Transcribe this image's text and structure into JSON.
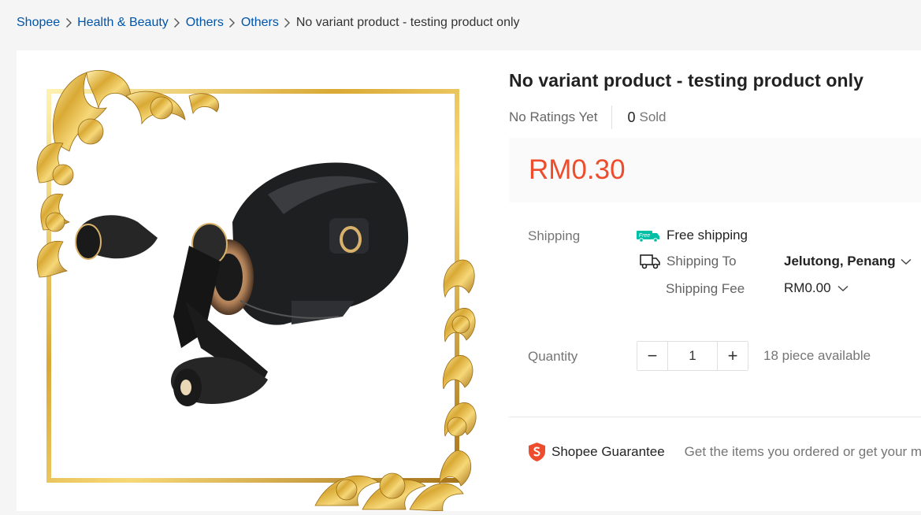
{
  "breadcrumb": {
    "items": [
      "Shopee",
      "Health & Beauty",
      "Others",
      "Others"
    ],
    "current": "No variant product - testing product only",
    "separator": ">"
  },
  "product": {
    "title": "No variant product - testing product only",
    "ratings_text": "No Ratings Yet",
    "sold_count": "0",
    "sold_label": "Sold",
    "price": "RM0.30",
    "image_icon": "fishing-reel-product-image"
  },
  "shipping": {
    "label": "Shipping",
    "free_badge": "Free",
    "free_shipping": "Free shipping",
    "shipping_to_label": "Shipping To",
    "shipping_to_value": "Jelutong, Penang",
    "shipping_fee_label": "Shipping Fee",
    "shipping_fee_value": "RM0.00"
  },
  "quantity": {
    "label": "Quantity",
    "value": "1",
    "minus": "−",
    "plus": "+",
    "available": "18 piece available"
  },
  "guarantee": {
    "label": "Shopee Guarantee",
    "text": "Get the items you ordered or get your m"
  },
  "colors": {
    "accent": "#ee4d2d",
    "link": "#0055aa",
    "free_shipping_teal": "#00bfa5"
  }
}
